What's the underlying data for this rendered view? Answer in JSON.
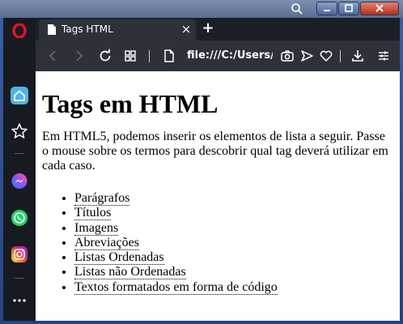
{
  "browser": {
    "tab_title": "Tags HTML",
    "address": "file:///C:/Users/J",
    "new_tab_symbol": "+",
    "close_tab_symbol": "×"
  },
  "page": {
    "heading": "Tags em HTML",
    "intro": "Em HTML5, podemos inserir os elementos de lista a seguir. Passe o mouse sobre os termos para descobrir qual tag deverá utilizar em cada caso.",
    "items": [
      "Parágrafos",
      "Títulos",
      "Imagens",
      "Abreviações",
      "Listas Ordenadas",
      "Listas não Ordenadas",
      "Textos formatados em forma de código"
    ]
  },
  "icons": {
    "window": [
      "search-icon",
      "minimize-icon",
      "maximize-icon",
      "close-icon"
    ],
    "sidebar": [
      "opera-logo",
      "home-icon",
      "star-icon",
      "messenger-icon",
      "whatsapp-icon",
      "instagram-icon",
      "more-icon"
    ],
    "toolbar": [
      "back-icon",
      "forward-icon",
      "reload-icon",
      "tabs-grid-icon",
      "page-icon",
      "camera-icon",
      "send-icon",
      "heart-icon",
      "download-icon",
      "settings-icon"
    ]
  },
  "colors": {
    "window_frame": "#24447f",
    "browser_chrome": "#2c313a",
    "sidebar": "#171a21",
    "opera_red": "#e0152b",
    "home_blue": "#4fb3e8",
    "messenger": "#7b4dff",
    "whatsapp": "#25d366",
    "instagram": "#e1306c",
    "page_bg": "#ffffff"
  }
}
